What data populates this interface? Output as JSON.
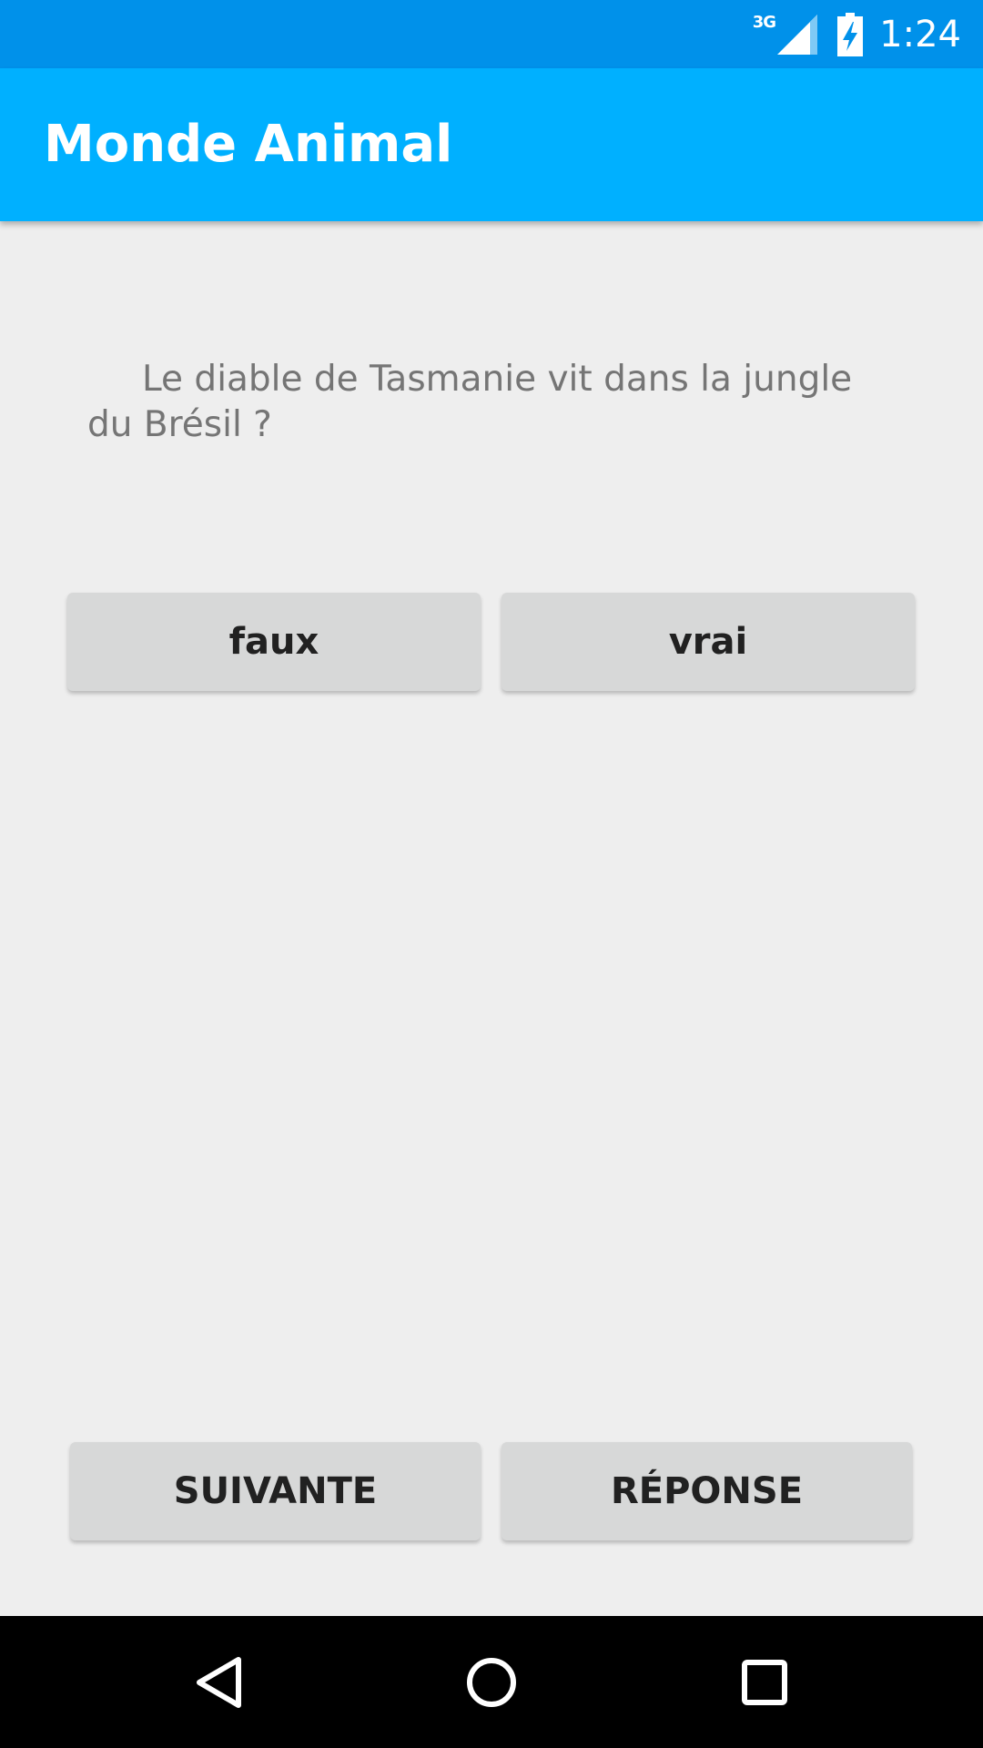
{
  "status_bar": {
    "network_type": "3G",
    "time": "1:24",
    "icons": [
      "signal-icon",
      "battery-charging-icon"
    ]
  },
  "app_bar": {
    "title": "Monde Animal"
  },
  "question": {
    "text": "Le diable de Tasmanie vit dans la jungle du Brésil ?"
  },
  "answers": {
    "false_label": "faux",
    "true_label": "vrai"
  },
  "actions": {
    "next_label": "SUIVANTE",
    "answer_label": "RÉPONSE"
  },
  "nav_bar": {
    "icons": [
      "back-icon",
      "home-icon",
      "recent-apps-icon"
    ]
  },
  "colors": {
    "status_bar": "#0091ea",
    "app_bar": "#00b0ff",
    "background": "#eeeeee",
    "button": "#d7d8d8",
    "question_text": "#757575",
    "nav_bar": "#000000"
  }
}
